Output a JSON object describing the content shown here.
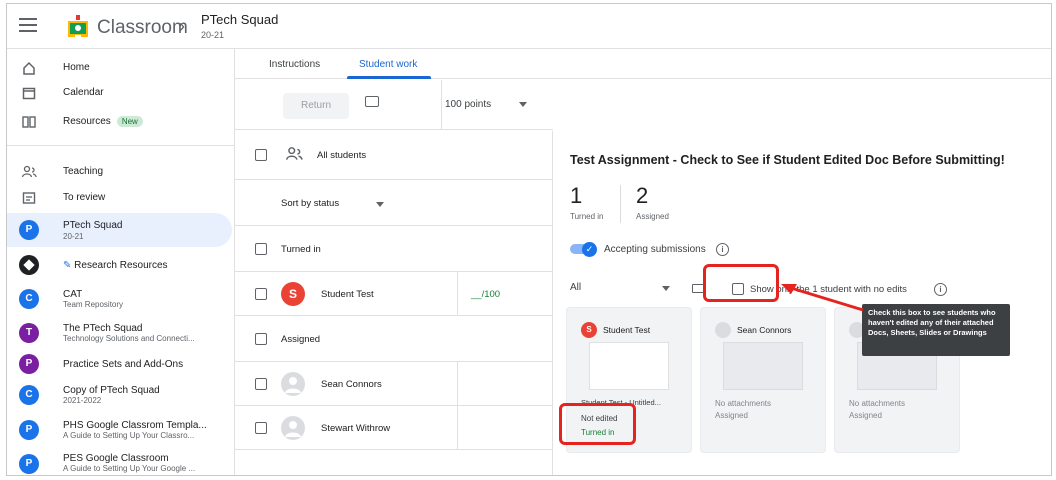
{
  "header": {
    "brand": "Classroom",
    "crumb_sep": "›",
    "class_title": "PTech Squad",
    "class_sub": "20-21"
  },
  "sidebar": {
    "home": "Home",
    "calendar": "Calendar",
    "resources": "Resources",
    "resources_badge": "New",
    "teaching": "Teaching",
    "to_review": "To review",
    "classes": [
      {
        "avatar": "P",
        "color": "#1a73e8",
        "title": "PTech Squad",
        "sub": "20-21"
      },
      {
        "avatar": "",
        "color": "#202124",
        "title": "Research Resources",
        "sub": ""
      },
      {
        "avatar": "C",
        "color": "#1a73e8",
        "title": "CAT",
        "sub": "Team Repository"
      },
      {
        "avatar": "T",
        "color": "#7b1fa2",
        "title": "The PTech Squad",
        "sub": "Technology Solutions and Connecti..."
      },
      {
        "avatar": "P",
        "color": "#7b1fa2",
        "title": "Practice Sets and Add-Ons",
        "sub": ""
      },
      {
        "avatar": "C",
        "color": "#1a73e8",
        "title": "Copy of PTech Squad",
        "sub": "2021-2022"
      },
      {
        "avatar": "P",
        "color": "#1a73e8",
        "title": "PHS Google Classrom Templa...",
        "sub": "A Guide to Setting Up Your Classro..."
      },
      {
        "avatar": "P",
        "color": "#1a73e8",
        "title": "PES Google Classroom",
        "sub": "A Guide to Setting Up Your Google ..."
      }
    ]
  },
  "tabs": {
    "instructions": "Instructions",
    "student_work": "Student work"
  },
  "toolbar": {
    "return_label": "Return",
    "points": "100 points"
  },
  "list": {
    "all_students": "All students",
    "sort": "Sort by status",
    "turned_in_header": "Turned in",
    "student_test": "Student Test",
    "student_test_avatar": "S",
    "student_test_grade": "__/100",
    "assigned_header": "Assigned",
    "sean": "Sean Connors",
    "stewart": "Stewart Withrow"
  },
  "detail": {
    "title": "Test Assignment - Check to See if Student Edited Doc Before Submitting!",
    "turned_in_count": "1",
    "turned_in_label": "Turned in",
    "assigned_count": "2",
    "assigned_label": "Assigned",
    "accepting": "Accepting submissions",
    "filter": "All",
    "show_only": "Show only the 1 student with no edits",
    "tooltip": "Check this box to see students who haven't edited any of their attached Docs, Sheets, Slides or Drawings",
    "cards": [
      {
        "avatar": "S",
        "name": "Student Test",
        "file": "Student Test - Untitled...",
        "status_a": "Not edited",
        "status_b": "Turned in"
      },
      {
        "avatar": "",
        "name": "Sean Connors",
        "note": "No attachments",
        "status": "Assigned"
      },
      {
        "avatar": "",
        "name": "",
        "note": "No attachments",
        "status": "Assigned"
      }
    ]
  },
  "colors": {
    "accent": "#1967d2",
    "highlight": "#e52420",
    "turned_in_green": "#188038",
    "student_test_avatar": "#ea4335"
  }
}
